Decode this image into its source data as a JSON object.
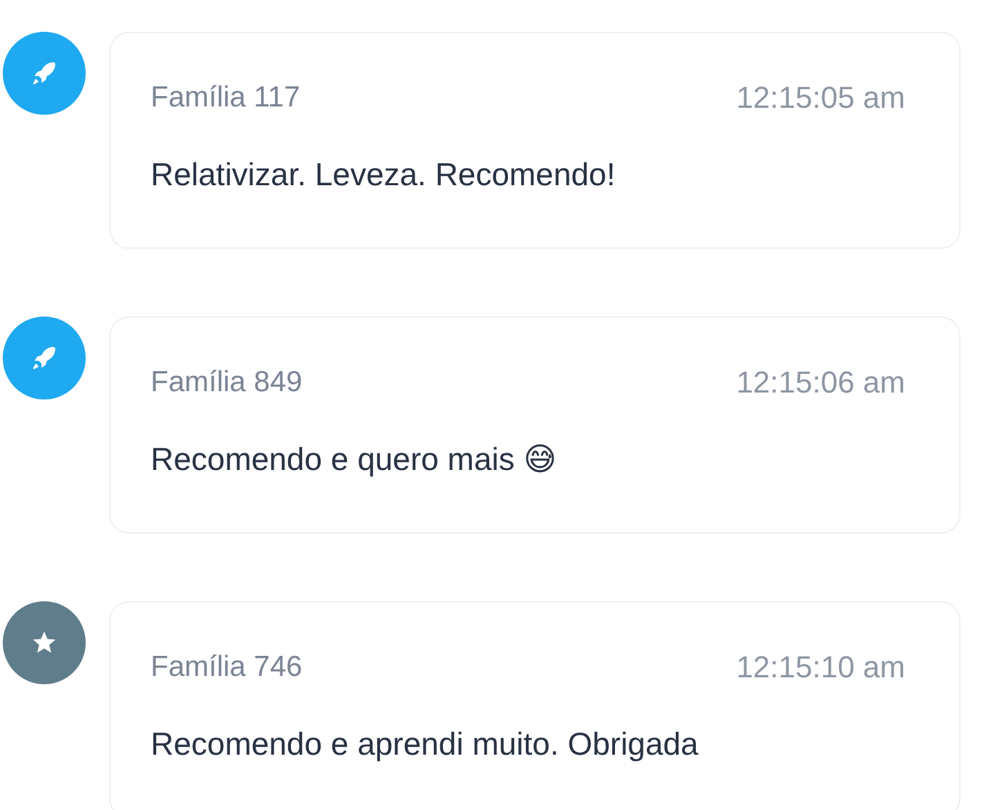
{
  "entries": [
    {
      "kind": "rocket",
      "color": "#1fa9f0",
      "author": "Família 117",
      "time": "12:15:05 am",
      "message": "Relativizar. Leveza. Recomendo!"
    },
    {
      "kind": "rocket",
      "color": "#1fa9f0",
      "author": "Família 849",
      "time": "12:15:06 am",
      "message": "Recomendo e quero mais 😅"
    },
    {
      "kind": "star",
      "color": "#607d8b",
      "author": "Família 746",
      "time": "12:15:10 am",
      "message": "Recomendo e aprendi muito. Obrigada"
    }
  ]
}
